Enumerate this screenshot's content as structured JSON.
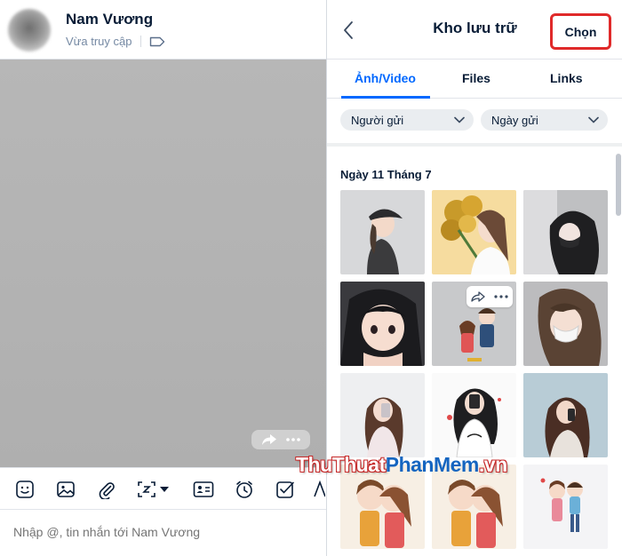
{
  "chat": {
    "contact_name": "Nam Vương",
    "status": "Vừa truy cập",
    "composer_placeholder": "Nhập @, tin nhắn tới Nam Vương",
    "toolbar_icons": [
      "sticker-icon",
      "image-icon",
      "attachment-icon",
      "screenshot-icon",
      "dropdown-caret-icon",
      "contact-card-icon",
      "reminder-clock-icon",
      "task-check-icon"
    ]
  },
  "storage": {
    "title": "Kho lưu trữ",
    "select_label": "Chọn",
    "tabs": [
      {
        "label": "Ảnh/Video",
        "active": true
      },
      {
        "label": "Files",
        "active": false
      },
      {
        "label": "Links",
        "active": false
      }
    ],
    "filters": [
      {
        "label": "Người gửi"
      },
      {
        "label": "Ngày gửi"
      }
    ],
    "date_group": "Ngày 11 Tháng 7"
  },
  "watermark": {
    "part1": "ThuThuat",
    "part2": "PhanMem",
    "part3": ".vn"
  },
  "colors": {
    "accent": "#0068ff",
    "highlight_border": "#e02a2a",
    "text_primary": "#081c36",
    "text_secondary": "#7589a3"
  }
}
